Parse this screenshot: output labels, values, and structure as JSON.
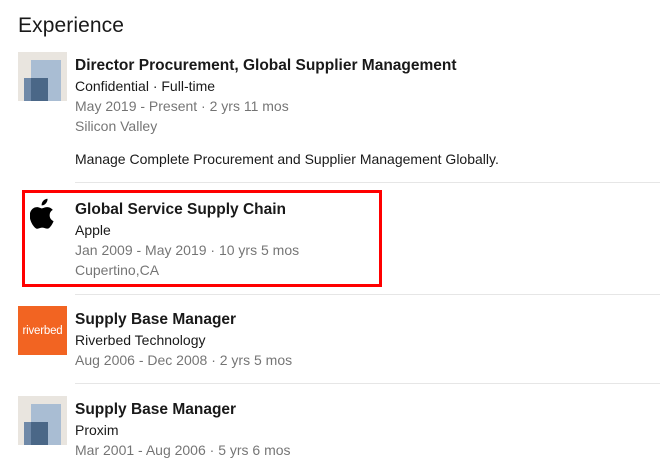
{
  "section": {
    "title": "Experience"
  },
  "entries": [
    {
      "title": "Director Procurement, Global Supplier Management",
      "company": "Confidential · Full-time",
      "dates": "May 2019 - Present · 2 yrs 11 mos",
      "location": "Silicon Valley",
      "description": "Manage Complete Procurement and Supplier Management Globally.",
      "logo": "company-placeholder-logo"
    },
    {
      "title": "Global Service Supply Chain",
      "company": "Apple",
      "dates": "Jan 2009 - May 2019 · 10 yrs 5 mos",
      "location": "Cupertino,CA",
      "logo": "apple-logo"
    },
    {
      "title": "Supply Base Manager",
      "company": "Riverbed Technology",
      "dates": "Aug 2006 - Dec 2008 · 2 yrs 5 mos",
      "logo": "riverbed-logo",
      "logo_text": "riverbed"
    },
    {
      "title": "Supply Base Manager",
      "company": "Proxim",
      "dates": "Mar 2001 - Aug 2006 · 5 yrs 6 mos",
      "logo": "company-placeholder-logo"
    }
  ],
  "colors": {
    "highlight_border": "#ff0000",
    "riverbed_brand": "#f26422",
    "meta_text": "#737373"
  }
}
